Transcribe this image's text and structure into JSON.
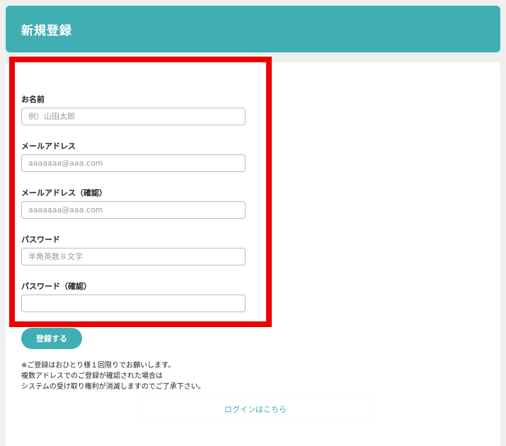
{
  "header": {
    "title": "新規登録"
  },
  "form": {
    "fields": [
      {
        "label": "お名前",
        "placeholder": "例）山田太郎",
        "value": ""
      },
      {
        "label": "メールアドレス",
        "placeholder": "aaaaaaa@aaa.com",
        "value": ""
      },
      {
        "label": "メールアドレス（確認）",
        "placeholder": "aaaaaaa@aaa.com",
        "value": ""
      },
      {
        "label": "パスワード",
        "placeholder": "半角英数８文字",
        "value": ""
      },
      {
        "label": "パスワード（確認）",
        "placeholder": "",
        "value": ""
      }
    ],
    "submit_label": "登録する"
  },
  "notice": {
    "lines": [
      "※ご登録はおひとり様１回限りでお願いします。",
      "複数アドレスでのご登録が確認された場合は",
      "システムの受け取り権利が消滅しますのでご了承下さい。"
    ]
  },
  "login": {
    "link_label": "ログインはこちら"
  },
  "colors": {
    "accent": "#3fafb4",
    "highlight": "#ee0000",
    "background": "#efeff0"
  }
}
